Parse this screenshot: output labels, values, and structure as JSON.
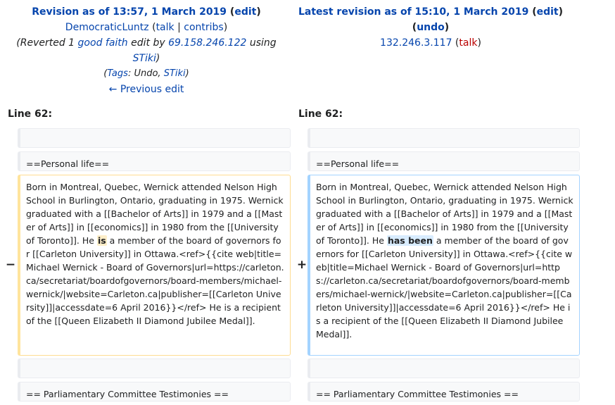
{
  "left_header": {
    "title_prefix": "Revision as of 13:57, 1 March 2019",
    "edit_link": "edit",
    "user": "DemocraticLuntz",
    "talk": "talk",
    "contribs": "contribs",
    "summary_prefix": "(Reverted 1 ",
    "good_faith": "good faith",
    "summary_mid": " edit by ",
    "ip": "69.158.246.122",
    "summary_using": " using",
    "stiki": "STiki",
    "summary_close": ")",
    "tags_label": "Tags",
    "tags_rest": ": Undo, ",
    "tag_stiki": "STiki",
    "prev_edit": "← Previous edit"
  },
  "right_header": {
    "title_prefix": "Latest revision as of 15:10, 1 March 2019",
    "edit_link": "edit",
    "undo_link": "undo",
    "user": "132.246.3.117",
    "talk": "talk"
  },
  "diff": {
    "left_line": "Line 62:",
    "right_line": "Line 62:",
    "heading": "==Personal life==",
    "minus": "−",
    "plus": "+",
    "left_pre": "Born in Montreal, Quebec, Wernick attended Nelson High School in Burlington, Ontario, graduating in 1975. Wernick graduated with a [[Bachelor of Arts]] in 1979 and a [[Master of Arts]] in [[economics]] in 1980 from the [[University of Toronto]]. He ",
    "left_changed": "is",
    "left_post": " a member of the board of governors for [[Carleton University]] in Ottawa.<ref>{{cite web|title=Michael Wernick - Board of Governors|url=https://carleton.ca/secretariat/boardofgovernors/board-members/michael-wernick/|website=Carleton.ca|publisher=[[Carleton University]]|accessdate=6 April 2016}}</ref> He is a recipient of the [[Queen Elizabeth II Diamond Jubilee Medal]].",
    "right_pre": "Born in Montreal, Quebec, Wernick attended Nelson High School in Burlington, Ontario, graduating in 1975. Wernick graduated with a [[Bachelor of Arts]] in 1979 and a [[Master of Arts]] in [[economics]] in 1980 from the [[University of Toronto]]. He ",
    "right_changed": "has been",
    "right_post": " a member of the board of governors for [[Carleton University]] in Ottawa.<ref>{{cite web|title=Michael Wernick - Board of Governors|url=https://carleton.ca/secretariat/boardofgovernors/board-members/michael-wernick/|website=Carleton.ca|publisher=[[Carleton University]]|accessdate=6 April 2016}}</ref> He is a recipient of the [[Queen Elizabeth II Diamond Jubilee Medal]].",
    "footer": "== Parliamentary Committee Testimonies =="
  }
}
